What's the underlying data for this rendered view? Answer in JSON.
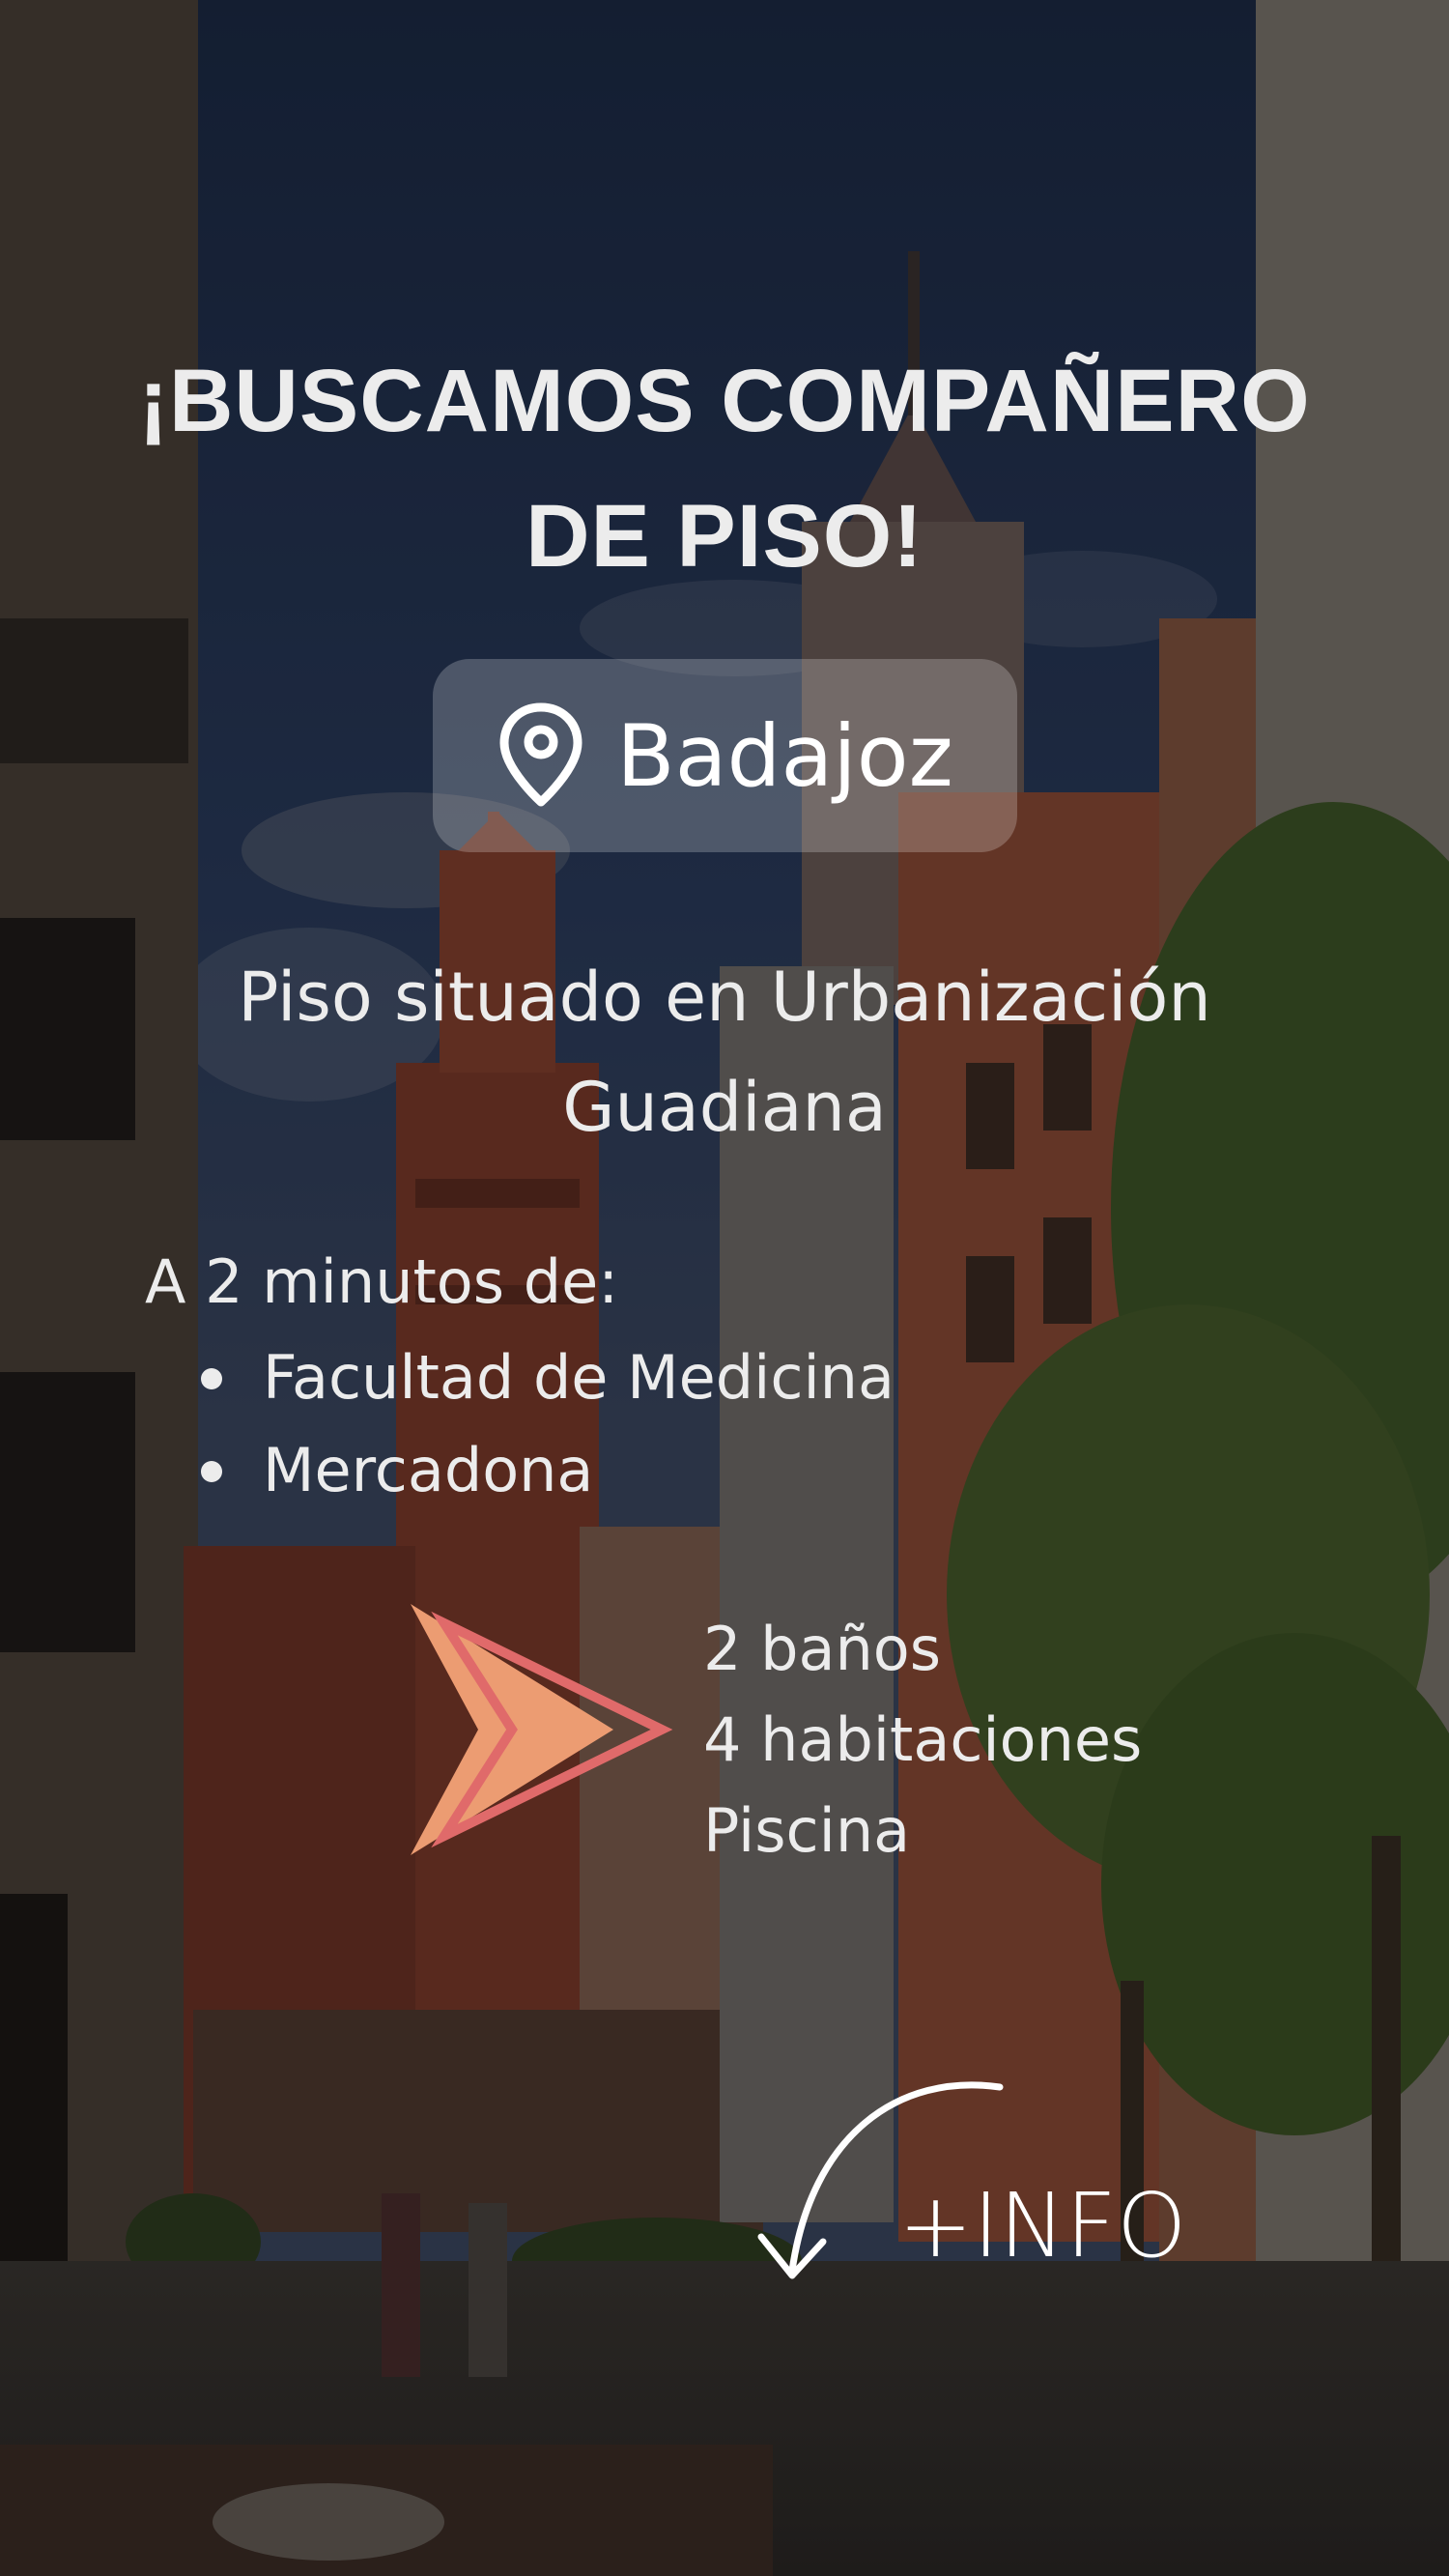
{
  "headline": {
    "line1": "¡BUSCAMOS COMPAÑERO",
    "line2": "DE PISO!"
  },
  "location": {
    "icon": "map-pin-icon",
    "city": "Badajoz"
  },
  "description": {
    "line1": "Piso situado en Urbanización",
    "line2": "Guadiana"
  },
  "proximity": {
    "title": "A 2 minutos de:",
    "items": [
      "Facultad de Medicina",
      "Mercadona"
    ]
  },
  "features": [
    "2 baños",
    "4 habitaciones",
    "Piscina"
  ],
  "cta": {
    "label": "+INFO",
    "icon": "curved-arrow-icon"
  },
  "colors": {
    "text": "#ececec",
    "arrow_fill": "#ec9c72",
    "arrow_outline": "#e06a6a"
  }
}
